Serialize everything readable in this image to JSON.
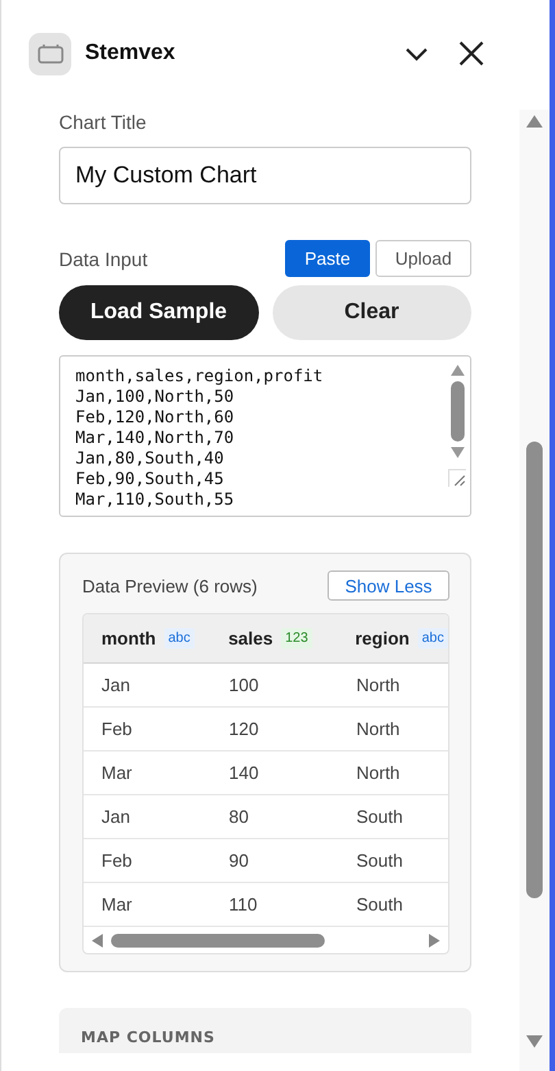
{
  "header": {
    "title": "Stemvex"
  },
  "chart_title": {
    "label": "Chart Title",
    "value": "My Custom Chart"
  },
  "data_input": {
    "label": "Data Input",
    "modes": [
      {
        "label": "Paste",
        "selected": true
      },
      {
        "label": "Upload",
        "selected": false
      }
    ],
    "actions": [
      {
        "label": "Load Sample",
        "kind": "primary"
      },
      {
        "label": "Clear",
        "kind": "secondary"
      }
    ],
    "lines": [
      "month,sales,region,profit",
      "Jan,100,North,50",
      "Feb,120,North,60",
      "Mar,140,North,70",
      "Jan,80,South,40",
      "Feb,90,South,45",
      "Mar,110,South,55"
    ]
  },
  "preview": {
    "title": "Data Preview (6 rows)",
    "toggle": "Show Less",
    "columns": [
      {
        "name": "month",
        "type": "abc",
        "kind": "text"
      },
      {
        "name": "sales",
        "type": "123",
        "kind": "number"
      },
      {
        "name": "region",
        "type": "abc",
        "kind": "text"
      }
    ],
    "rows": [
      [
        "Jan",
        "100",
        "North"
      ],
      [
        "Feb",
        "120",
        "North"
      ],
      [
        "Mar",
        "140",
        "North"
      ],
      [
        "Jan",
        "80",
        "South"
      ],
      [
        "Feb",
        "90",
        "South"
      ],
      [
        "Mar",
        "110",
        "South"
      ]
    ]
  },
  "next_section": {
    "title": "MAP COLUMNS"
  }
}
